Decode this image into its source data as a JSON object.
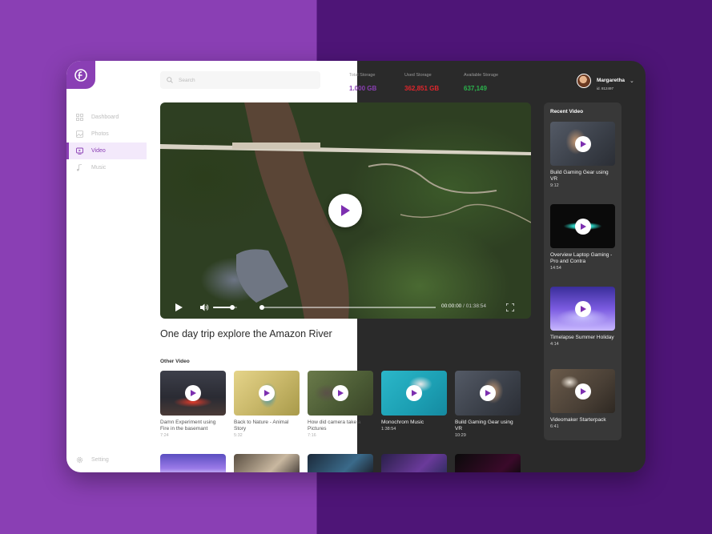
{
  "app": {
    "logo": "f-logo-icon",
    "accent": "#8a3fb4"
  },
  "sidebar": {
    "items": [
      {
        "label": "Dashboard",
        "icon": "grid-icon"
      },
      {
        "label": "Photos",
        "icon": "image-icon"
      },
      {
        "label": "Video",
        "icon": "video-icon",
        "active": true
      },
      {
        "label": "Music",
        "icon": "music-icon"
      }
    ],
    "setting": {
      "label": "Setting",
      "icon": "gear-icon"
    }
  },
  "header": {
    "search_placeholder": "Search",
    "stats": [
      {
        "label": "Total Storage",
        "value": "1.000 GB",
        "color": "#8a3fb4"
      },
      {
        "label": "Used Storage",
        "value": "362,851 GB",
        "color": "#e0262c"
      },
      {
        "label": "Available Storage",
        "value": "637,149",
        "color": "#2bb24c"
      }
    ],
    "user": {
      "name": "Margaretha",
      "id": "id. 812497"
    }
  },
  "player": {
    "current_time": "00:00:00",
    "separator": " / ",
    "duration": "01:38:54",
    "volume": 0.8,
    "progress": 0,
    "title": "One day trip explore the Amazon River"
  },
  "other_video": {
    "heading": "Other Video",
    "items": [
      {
        "title": "Damn Experiment using Fire in the basemant",
        "duration": "7:24"
      },
      {
        "title": "Back to Nature - Animal Story",
        "duration": "5:32"
      },
      {
        "title": "How did camera take a Pictures",
        "duration": "7:16"
      },
      {
        "title": "Monochrom Music",
        "duration": "1:38:54"
      },
      {
        "title": "Build Gaming Gear using VR",
        "duration": "10:29"
      }
    ]
  },
  "recent_video": {
    "heading": "Recent Video",
    "items": [
      {
        "title": "Build Gaming Gear using VR",
        "duration": "9:12"
      },
      {
        "title": "Overview Laptop Gaming - Pro and Contra",
        "duration": "14:54"
      },
      {
        "title": "Timelapse Summer Holiday",
        "duration": "4:14"
      },
      {
        "title": "Videomaker Starterpack",
        "duration": "6:41"
      }
    ]
  }
}
